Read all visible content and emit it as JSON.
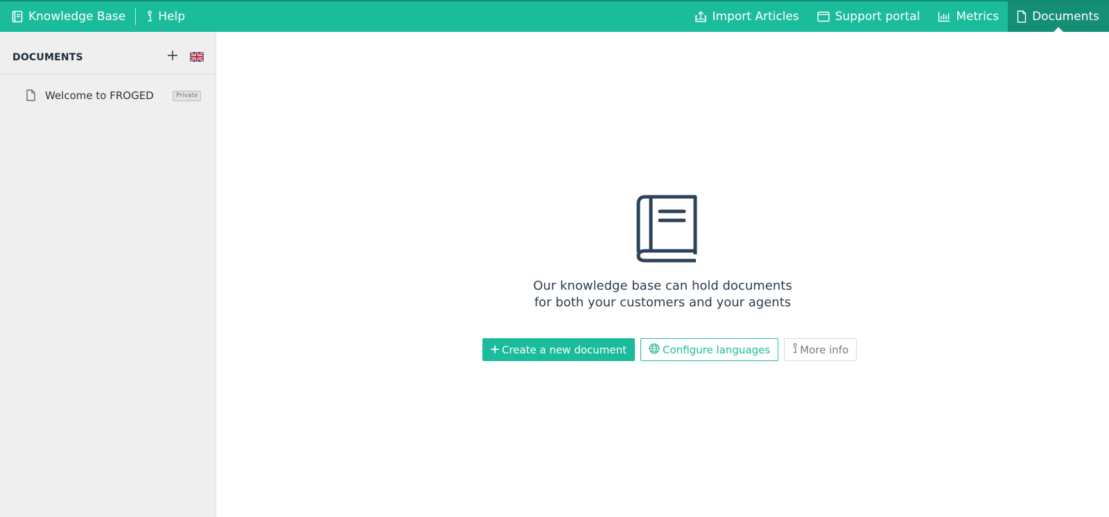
{
  "topbar": {
    "title": "Knowledge Base",
    "title_icon": "book-icon",
    "help_label": "Help",
    "help_icon": "info-icon",
    "nav": [
      {
        "label": "Import Articles",
        "icon": "upload-icon",
        "active": false
      },
      {
        "label": "Support portal",
        "icon": "browser-window-icon",
        "active": false
      },
      {
        "label": "Metrics",
        "icon": "bar-chart-icon",
        "active": false
      },
      {
        "label": "Documents",
        "icon": "document-icon",
        "active": true
      }
    ]
  },
  "sidebar": {
    "title": "DOCUMENTS",
    "add_icon": "plus-icon",
    "language_icon": "uk-flag-icon",
    "documents": [
      {
        "label": "Welcome to FROGED",
        "badge": "Private",
        "icon": "document-icon"
      }
    ]
  },
  "main": {
    "icon": "book-icon",
    "message_line1": "Our knowledge base can hold documents",
    "message_line2": "for both your customers and your agents",
    "actions": {
      "create_label": "Create a new document",
      "configure_label": "Configure languages",
      "more_info_label": "More info"
    }
  },
  "colors": {
    "brand": "#1bbc9b",
    "brand_dark": "#158e76",
    "sidebar_bg": "#efefef",
    "text": "#2b3c4e"
  }
}
